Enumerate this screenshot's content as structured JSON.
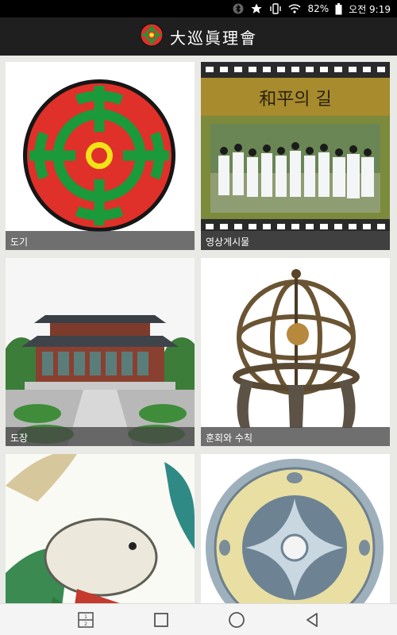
{
  "status_bar": {
    "battery": "82%",
    "time": "오전 9:19",
    "icons": [
      "bluetooth-icon",
      "star-icon",
      "vibrate-icon",
      "wifi-icon",
      "battery-icon"
    ]
  },
  "header": {
    "title": "大巡眞理會"
  },
  "tiles": [
    {
      "label": "도기"
    },
    {
      "label": "영상게시물",
      "banner_text": "和平의 길"
    },
    {
      "label": "도장"
    },
    {
      "label": "훈회와 수칙"
    },
    {
      "label": ""
    },
    {
      "label": ""
    }
  ],
  "nav_bar": {
    "buttons": [
      "dual-window-icon",
      "recents-icon",
      "home-icon",
      "back-icon"
    ],
    "dual_window_numbers": "1 2"
  },
  "colors": {
    "header_bg": "#1f1f1f",
    "caption_bg": "#464646",
    "emblem_red": "#e0302a",
    "emblem_green": "#1a9a3a",
    "emblem_yellow": "#f1e316"
  }
}
